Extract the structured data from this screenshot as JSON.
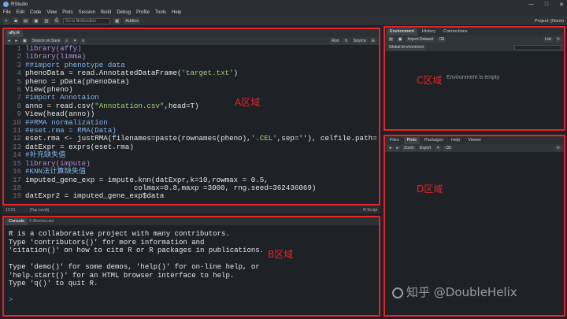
{
  "window": {
    "title": "RStudio",
    "controls": [
      "—",
      "□",
      "✕"
    ]
  },
  "menu": [
    "File",
    "Edit",
    "Code",
    "View",
    "Plots",
    "Session",
    "Build",
    "Debug",
    "Profile",
    "Tools",
    "Help"
  ],
  "toolbar": {
    "goto_placeholder": "Go to file/function",
    "addins": "Addins",
    "project": "Project: (None)"
  },
  "editor": {
    "tab": "affy.R",
    "source_on_save": "Source on Save",
    "run": "Run",
    "source": "Source",
    "lines": [
      {
        "n": "1",
        "segments": [
          {
            "t": "library(affy)",
            "c": "lib"
          }
        ]
      },
      {
        "n": "2",
        "segments": [
          {
            "t": "library(limma)",
            "c": "lib"
          }
        ]
      },
      {
        "n": "3",
        "segments": [
          {
            "t": "##import phenotype data",
            "c": "cm"
          }
        ]
      },
      {
        "n": "4",
        "segments": [
          {
            "t": "phenoData = read.AnnotatedDataFrame(",
            "c": ""
          },
          {
            "t": "'target.txt'",
            "c": "str"
          },
          {
            "t": ")",
            "c": ""
          }
        ]
      },
      {
        "n": "5",
        "segments": [
          {
            "t": "pheno = pData(phenoData)",
            "c": ""
          }
        ]
      },
      {
        "n": "6",
        "segments": [
          {
            "t": "View(pheno)",
            "c": ""
          }
        ]
      },
      {
        "n": "7",
        "segments": [
          {
            "t": "#import Annotaion",
            "c": "cm"
          }
        ]
      },
      {
        "n": "8",
        "segments": [
          {
            "t": "anno = read.csv(",
            "c": ""
          },
          {
            "t": "\"Annotation.csv\"",
            "c": "str"
          },
          {
            "t": ",head=T)",
            "c": ""
          }
        ]
      },
      {
        "n": "9",
        "segments": [
          {
            "t": "View(head(anno))",
            "c": ""
          }
        ]
      },
      {
        "n": "10",
        "segments": [
          {
            "t": "##RMA normalization",
            "c": "cm"
          }
        ]
      },
      {
        "n": "11",
        "segments": [
          {
            "t": "#eset.rma = RMA(Data)",
            "c": "cm"
          }
        ]
      },
      {
        "n": "12",
        "segments": [
          {
            "t": "eset.rma <- justRMA(filenames=paste(rownames(pheno),",
            "c": ""
          },
          {
            "t": "'.CEL'",
            "c": "str"
          },
          {
            "t": ",sep=''), celfile.path=",
            "c": ""
          }
        ]
      },
      {
        "n": "13",
        "segments": [
          {
            "t": "datExpr = exprs(eset.rma)",
            "c": ""
          }
        ]
      },
      {
        "n": "14",
        "segments": [
          {
            "t": "#补充缺失值",
            "c": "cm"
          }
        ]
      },
      {
        "n": "15",
        "segments": [
          {
            "t": "library(impute)",
            "c": "lib"
          }
        ]
      },
      {
        "n": "16",
        "segments": [
          {
            "t": "#KNN法计算缺失值",
            "c": "cm"
          }
        ]
      },
      {
        "n": "17",
        "segments": [
          {
            "t": "imputed_gene_exp = impute.knn(datExpr,k=10,rowmax = 0.5,",
            "c": ""
          }
        ]
      },
      {
        "n": "18",
        "segments": [
          {
            "t": "                         colmax=0.8,maxp =3000, rng.seed=362436069)",
            "c": ""
          }
        ]
      },
      {
        "n": "19",
        "segments": [
          {
            "t": "datExpr2 = imputed_gene_exp$data",
            "c": ""
          }
        ]
      }
    ],
    "status_pos": "12:51",
    "status_level": "(Top Level)",
    "status_type": "R Script"
  },
  "console": {
    "tab": "Console",
    "path": "F:/BioInfoLab/",
    "lines": [
      "R is a collaborative project with many contributors.",
      "Type 'contributors()' for more information and",
      "'citation()' on how to cite R or R packages in publications.",
      "",
      "Type 'demo()' for some demos, 'help()' for on-line help, or",
      "'help.start()' for an HTML browser interface to help.",
      "Type 'q()' to quit R.",
      ""
    ],
    "prompt": ">"
  },
  "environment": {
    "tabs": [
      "Environment",
      "History",
      "Connections"
    ],
    "import_label": "Import Dataset",
    "list_label": "List",
    "scope": "Global Environment",
    "empty_text": "Environment is empty"
  },
  "files": {
    "tabs": [
      "Files",
      "Plots",
      "Packages",
      "Help",
      "Viewer"
    ],
    "zoom": "Zoom",
    "export": "Export"
  },
  "labels": {
    "A": "A区域",
    "B": "B区域",
    "C": "C区域",
    "D": "D区域"
  },
  "watermark": "知乎 @DoubleHelix",
  "colors": {
    "accent_border": "#e0262b",
    "comment": "#86b5e8",
    "string": "#9fd17a",
    "library": "#b38fd6"
  }
}
